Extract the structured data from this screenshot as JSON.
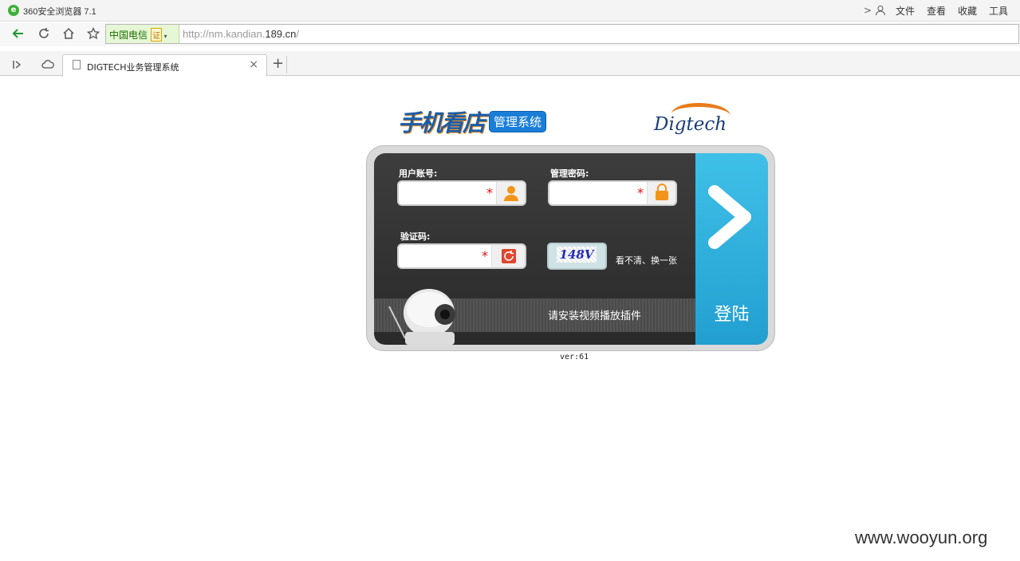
{
  "browser": {
    "title": "360安全浏览器 7.1",
    "menu": [
      "文件",
      "查看",
      "收藏",
      "工具"
    ],
    "isp_label": "中国电信",
    "isp_badge": "证",
    "url_prefix": "http://nm.kandian.",
    "url_domain": "189.cn",
    "url_suffix": "/",
    "tab_title": "DIGTECH业务管理系统"
  },
  "header": {
    "brand_main": "手机看店",
    "brand_sub": "管理系统",
    "company": "Digtech"
  },
  "form": {
    "username_label": "用户账号:",
    "password_label": "管理密码:",
    "captcha_label": "验证码:",
    "required_mark": "*",
    "captcha_code": "148V",
    "refresh_text": "看不清、换一张",
    "plugin_notice": "请安装视频播放插件",
    "login_label": "登陆"
  },
  "footer": {
    "version": "ver:61",
    "watermark": "www.wooyun.org"
  },
  "colors": {
    "login_blue": "#2fb0dc",
    "panel_dark": "#333333",
    "accent_orange": "#f29418"
  },
  "icons": [
    "back-arrow-icon",
    "refresh-icon",
    "home-icon",
    "star-icon",
    "sidebar-toggle-icon",
    "cloud-icon",
    "document-icon",
    "close-icon",
    "plus-icon",
    "user-icon",
    "lock-icon",
    "captcha-refresh-icon",
    "chevron-right-icon"
  ]
}
